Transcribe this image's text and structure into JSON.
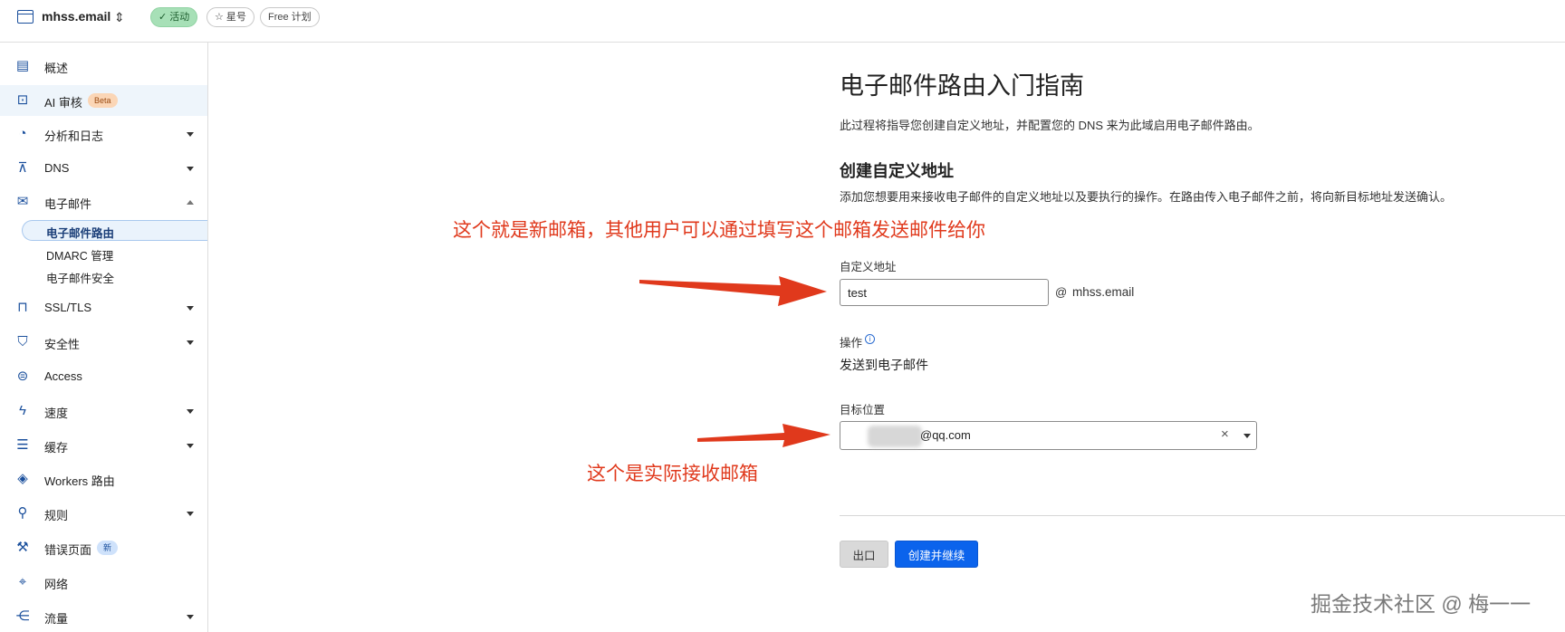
{
  "topbar": {
    "site_name": "mhss.email",
    "status": "✓ 活动",
    "star": "☆ 星号",
    "plan": "Free 计划"
  },
  "sidebar": {
    "items": [
      {
        "label": "概述",
        "icon": "clipboard-icon"
      },
      {
        "label": "AI 审核",
        "icon": "robot-icon",
        "badge": "Beta"
      },
      {
        "label": "分析和日志",
        "icon": "chart-pie-icon"
      },
      {
        "label": "DNS",
        "icon": "network-icon"
      },
      {
        "label": "电子邮件",
        "icon": "envelope-icon"
      },
      {
        "label": "SSL/TLS",
        "icon": "lock-icon"
      },
      {
        "label": "安全性",
        "icon": "shield-icon"
      },
      {
        "label": "Access",
        "icon": "access-icon"
      },
      {
        "label": "速度",
        "icon": "lightning-icon"
      },
      {
        "label": "缓存",
        "icon": "cache-icon"
      },
      {
        "label": "Workers 路由",
        "icon": "workers-icon"
      },
      {
        "label": "规则",
        "icon": "rules-icon"
      },
      {
        "label": "错误页面",
        "icon": "wrench-icon",
        "badge": "新"
      },
      {
        "label": "网络",
        "icon": "location-icon"
      },
      {
        "label": "流量",
        "icon": "traffic-icon"
      }
    ],
    "email_sub": [
      {
        "label": "电子邮件路由"
      },
      {
        "label": "DMARC 管理"
      },
      {
        "label": "电子邮件安全"
      }
    ]
  },
  "main": {
    "title": "电子邮件路由入门指南",
    "description": "此过程将指导您创建自定义地址，并配置您的 DNS 来为此域启用电子邮件路由。",
    "section_title": "创建自定义地址",
    "section_description": "添加您想要用来接收电子邮件的自定义地址以及要执行的操作。在路由传入电子邮件之前，将向新目标地址发送确认。",
    "custom_address_label": "自定义地址",
    "custom_address_value": "test",
    "at_sign": "@",
    "domain": "mhss.email",
    "action_label": "操作",
    "action_value": "发送到电子邮件",
    "destination_label": "目标位置",
    "destination_value": "@qq.com",
    "exit_button": "出口",
    "create_button": "创建并继续"
  },
  "annotations": {
    "note_new_mailbox": "这个就是新邮箱，其他用户可以通过填写这个邮箱发送邮件给你",
    "note_receive_mailbox": "这个是实际接收邮箱",
    "color": "#e0391c"
  },
  "watermark": "掘金技术社区 @ 梅一一"
}
